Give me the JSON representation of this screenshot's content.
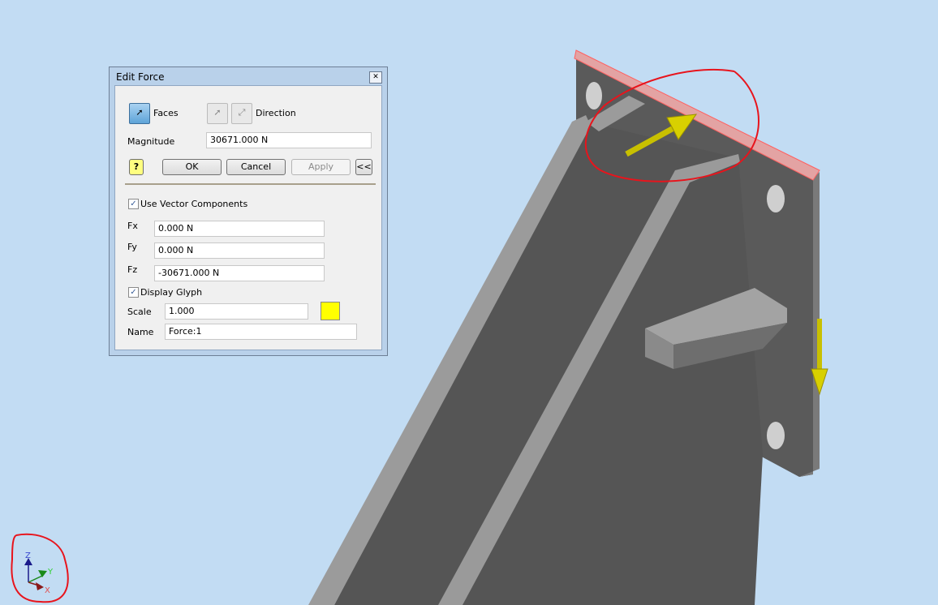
{
  "dialog": {
    "title": "Edit Force",
    "faces_label": "Faces",
    "direction_label": "Direction",
    "magnitude_label": "Magnitude",
    "magnitude_value": "30671.000 N",
    "ok": "OK",
    "cancel": "Cancel",
    "apply": "Apply",
    "collapse": "<<",
    "help": "?",
    "use_vector_components": "Use Vector Components",
    "use_vector_components_checked": true,
    "fx_label": "Fx",
    "fx_value": "0.000 N",
    "fy_label": "Fy",
    "fy_value": "0.000 N",
    "fz_label": "Fz",
    "fz_value": "-30671.000 N",
    "display_glyph": "Display Glyph",
    "display_glyph_checked": true,
    "scale_label": "Scale",
    "scale_value": "1.000",
    "glyph_color": "#ffff00",
    "name_label": "Name",
    "name_value": "Force:1"
  },
  "triad": {
    "z": "Z",
    "y": "Y",
    "x": "X"
  },
  "colors": {
    "background": "#c2dcf3",
    "annotation": "#e8141c",
    "glyph": "#d8d000",
    "selected_face": "#e8a0a0"
  }
}
